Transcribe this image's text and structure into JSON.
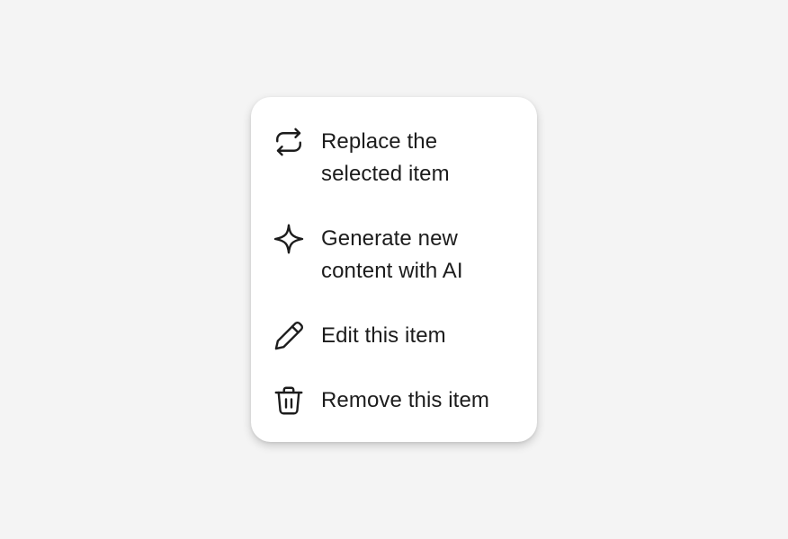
{
  "menu": {
    "items": [
      {
        "icon": "repeat-icon",
        "label_line1": "Replace the",
        "label_line2": "selected item"
      },
      {
        "icon": "sparkle-icon",
        "label_line1": "Generate new",
        "label_line2": "content with AI"
      },
      {
        "icon": "pencil-icon",
        "label_line1": "Edit this item"
      },
      {
        "icon": "trash-icon",
        "label_line1": "Remove this item"
      }
    ]
  }
}
